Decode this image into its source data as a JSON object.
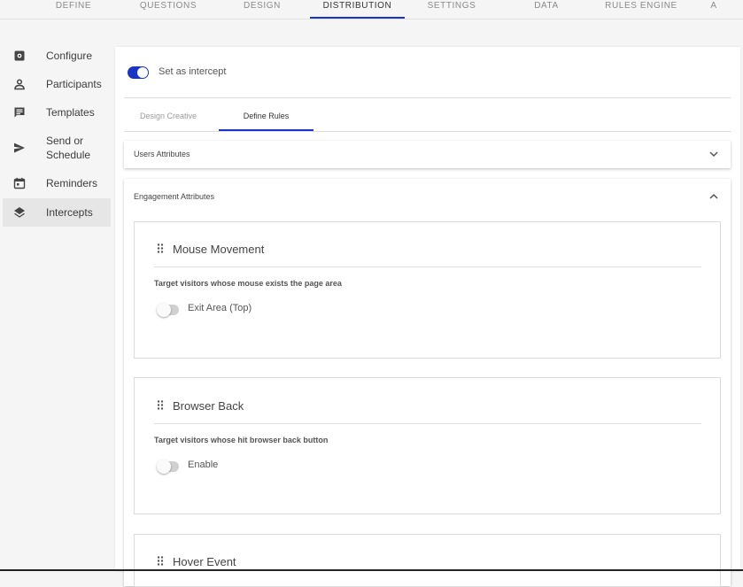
{
  "topnav": {
    "tabs": [
      {
        "label": "DEFINE",
        "active": false
      },
      {
        "label": "QUESTIONS",
        "active": false
      },
      {
        "label": "DESIGN",
        "active": false
      },
      {
        "label": "DISTRIBUTION",
        "active": true
      },
      {
        "label": "SETTINGS",
        "active": false
      },
      {
        "label": "DATA",
        "active": false
      },
      {
        "label": "RULES ENGINE",
        "active": false
      },
      {
        "label": "A",
        "active": false
      }
    ]
  },
  "sidebar": {
    "items": [
      {
        "label": "Configure",
        "icon": "gear-icon",
        "active": false
      },
      {
        "label": "Participants",
        "icon": "person-icon",
        "active": false
      },
      {
        "label": "Templates",
        "icon": "message-icon",
        "active": false
      },
      {
        "label": "Send or",
        "label2": "Schedule",
        "icon": "send-icon",
        "active": false
      },
      {
        "label": "Reminders",
        "icon": "calendar-icon",
        "active": false
      },
      {
        "label": "Intercepts",
        "icon": "layers-icon",
        "active": true
      }
    ]
  },
  "main": {
    "intercept_toggle": {
      "label": "Set as intercept",
      "on": true
    },
    "subtabs": [
      {
        "label": "Design Creative",
        "active": false
      },
      {
        "label": "Define Rules",
        "active": true
      }
    ],
    "users_panel": {
      "title": "Users Attributes",
      "expanded": false
    },
    "engagement_panel": {
      "title": "Engagement Attributes",
      "expanded": true
    },
    "cards": [
      {
        "title": "Mouse Movement",
        "description": "Target visitors whose mouse exists the page area",
        "option": "Exit Area (Top)",
        "on": false
      },
      {
        "title": "Browser Back",
        "description": "Target visitors whose hit browser back button",
        "option": "Enable",
        "on": false
      },
      {
        "title": "Hover Event"
      }
    ]
  },
  "colors": {
    "accent": "#1a34c8",
    "background": "#f5f5f5"
  }
}
